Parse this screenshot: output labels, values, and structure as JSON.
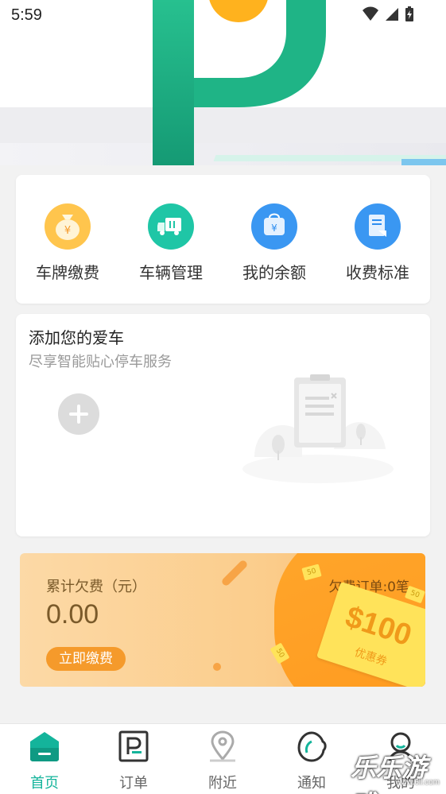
{
  "status_bar": {
    "time": "5:59",
    "icons": [
      "wifi-icon",
      "signal-icon",
      "battery-charging-icon"
    ]
  },
  "quick_actions": [
    {
      "label": "车牌缴费",
      "icon": "money-bag-icon",
      "color": "#fbb03b"
    },
    {
      "label": "车辆管理",
      "icon": "truck-icon",
      "color": "#19c2a5"
    },
    {
      "label": "我的余额",
      "icon": "wallet-bag-icon",
      "color": "#2d8ef0"
    },
    {
      "label": "收费标准",
      "icon": "document-icon",
      "color": "#2d8ef0"
    }
  ],
  "add_car": {
    "title": "添加您的爱车",
    "subtitle": "尽享智能贴心停车服务"
  },
  "arrears": {
    "label": "累计欠费（元）",
    "amount": "0.00",
    "pay_button": "立即缴费",
    "orders": "欠费订单:0笔",
    "coupon_value": "$100",
    "coupon_text": "优惠券",
    "coin_label": "50"
  },
  "bottom_nav": [
    {
      "label": "首页",
      "icon": "home-icon",
      "active": true
    },
    {
      "label": "订单",
      "icon": "parking-order-icon",
      "active": false
    },
    {
      "label": "附近",
      "icon": "location-pin-icon",
      "active": false
    },
    {
      "label": "通知",
      "icon": "notification-icon",
      "active": false
    },
    {
      "label": "我的",
      "icon": "profile-icon",
      "active": false
    }
  ],
  "watermark": {
    "text": "乐乐游戏",
    "url": "www.6ll.com"
  },
  "colors": {
    "brand_green": "#14b49b",
    "banner_orange": "#f59a2b"
  }
}
